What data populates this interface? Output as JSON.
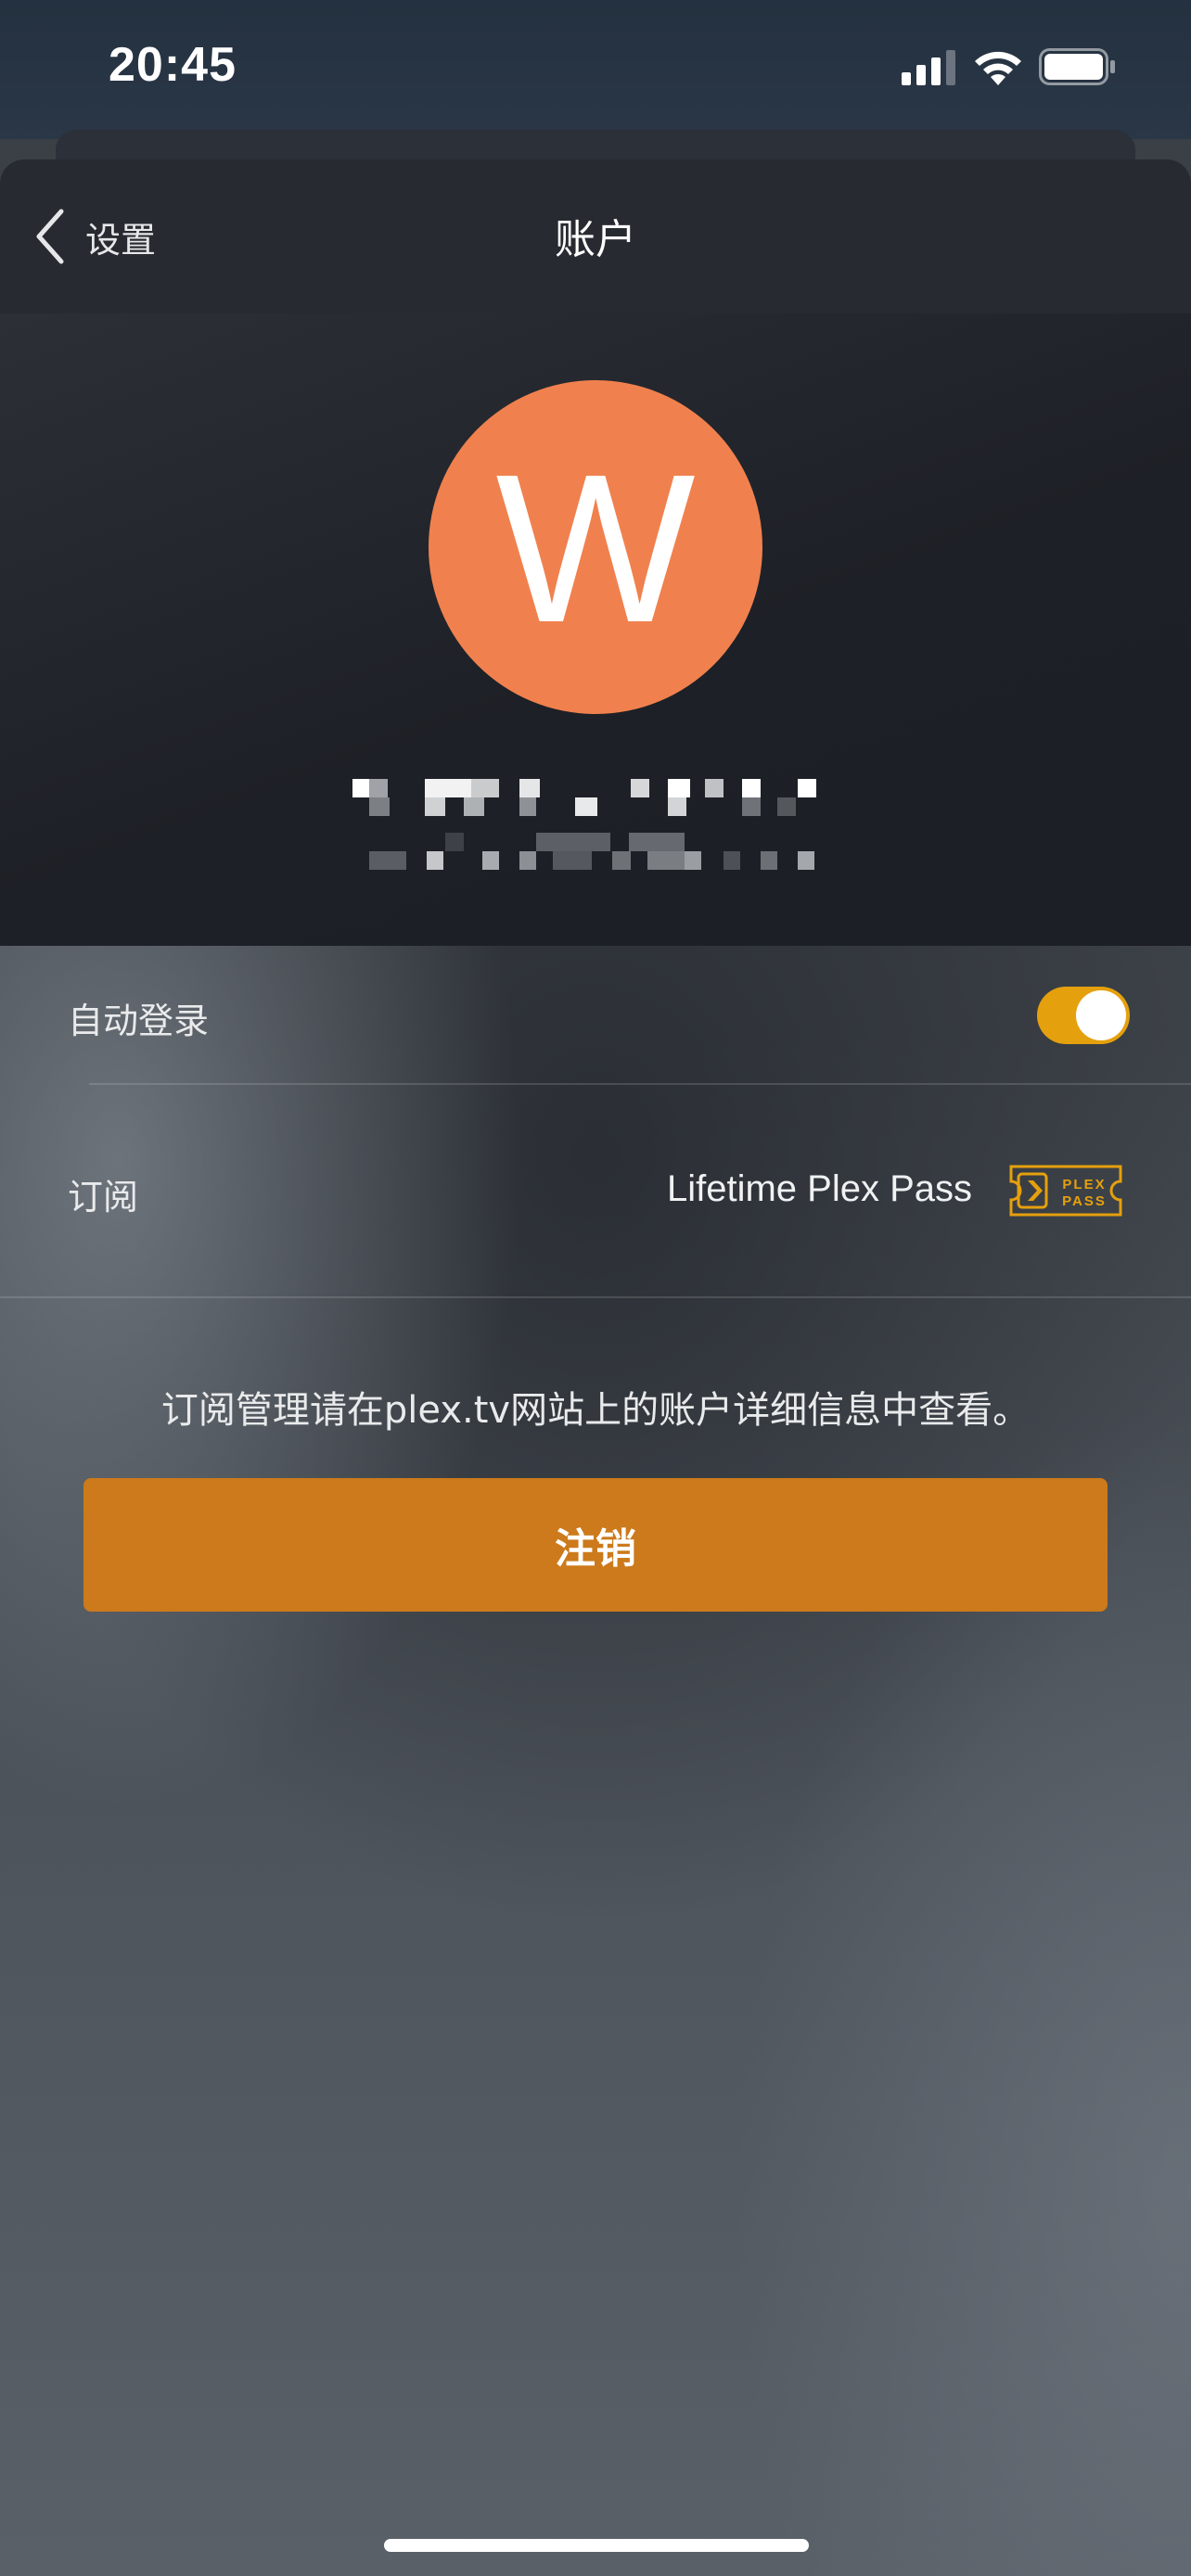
{
  "status_bar": {
    "time": "20:45"
  },
  "nav": {
    "back_label": "设置",
    "title": "账户"
  },
  "profile": {
    "avatar_letter": "W",
    "avatar_color": "#f0814e"
  },
  "settings": {
    "auto_login": {
      "label": "自动登录",
      "enabled": true
    },
    "subscription": {
      "label": "订阅",
      "value": "Lifetime Plex Pass",
      "badge_text": "PLEX PASS"
    }
  },
  "info_text": "订阅管理请在plex.tv网站上的账户详细信息中查看。",
  "logout_button": {
    "label": "注销",
    "color": "#cc7a1b"
  },
  "colors": {
    "accent": "#e5a00d"
  }
}
